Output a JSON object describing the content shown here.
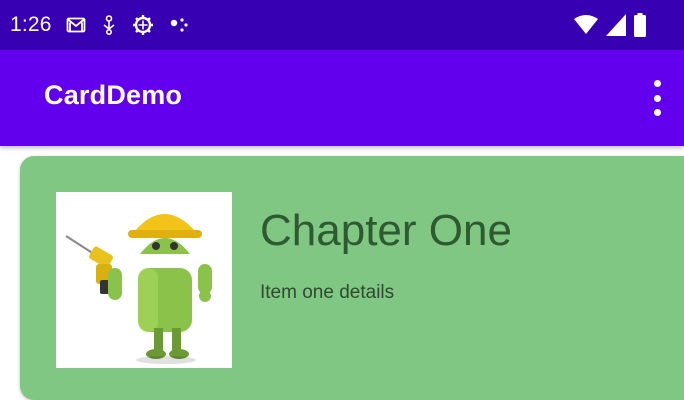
{
  "status_bar": {
    "time": "1:26",
    "icons": [
      "gmail-icon",
      "usb-icon",
      "settings-cog-icon",
      "dots-icon"
    ],
    "right_icons": [
      "wifi-icon",
      "cellular-signal-icon",
      "battery-icon"
    ],
    "background": "#3700b3"
  },
  "app_bar": {
    "title": "CardDemo",
    "menu_icon": "more-vert-icon",
    "background": "#6200ee"
  },
  "card": {
    "title": "Chapter One",
    "subtitle": "Item one details",
    "image": "android-robot-with-drill",
    "background": "#81c784"
  }
}
